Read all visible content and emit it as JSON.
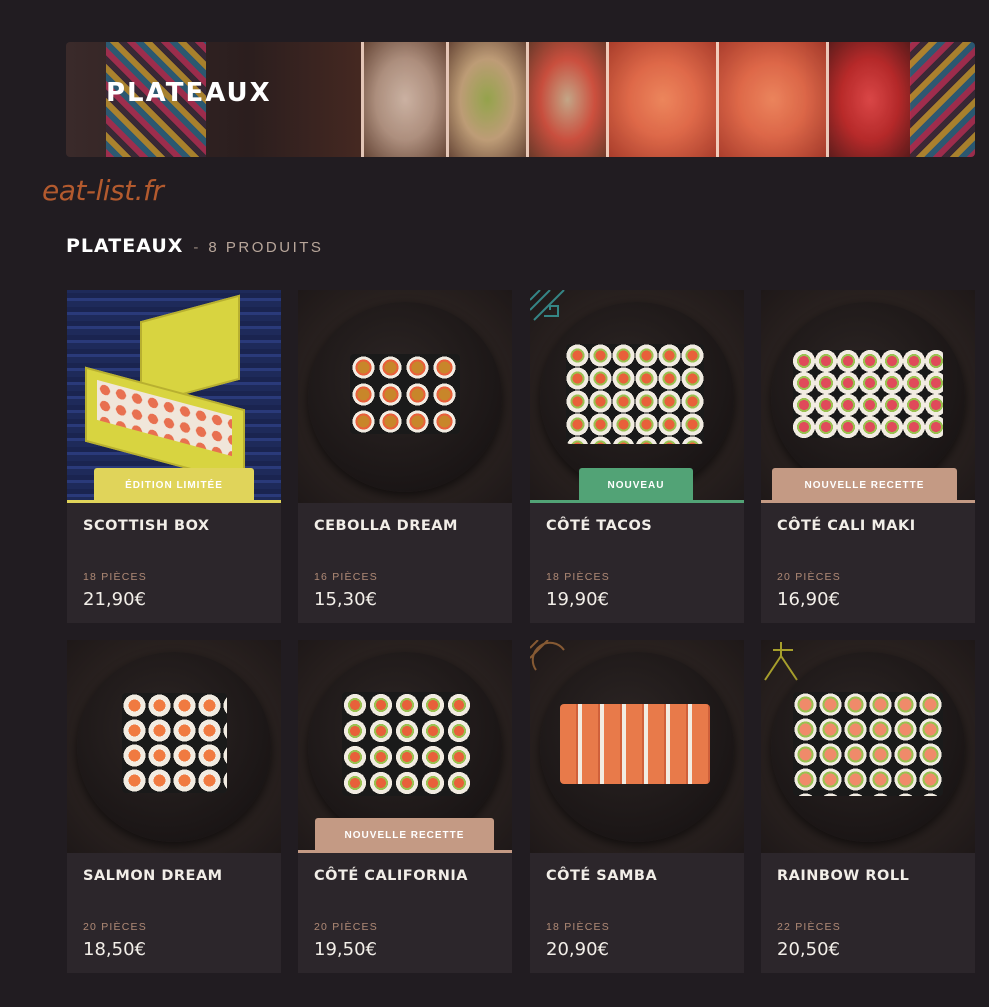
{
  "banner": {
    "title": "PLATEAUX"
  },
  "watermark": "eat-list.fr",
  "section": {
    "title": "PLATEAUX",
    "separator": "-",
    "count": "8 PRODUITS"
  },
  "colors": {
    "background": "#211c21",
    "card": "#2c262b",
    "badge_limited": "#e0d45a",
    "badge_new": "#52a376",
    "badge_recipe": "#c49a84",
    "price_pieces": "#b08a76"
  },
  "products": [
    {
      "name": "SCOTTISH BOX",
      "pieces": "18 PIÈCES",
      "price": "21,90€",
      "badge": "ÉDITION LIMITÉE"
    },
    {
      "name": "CEBOLLA DREAM",
      "pieces": "16 PIÈCES",
      "price": "15,30€",
      "badge": ""
    },
    {
      "name": "CÔTÉ TACOS",
      "pieces": "18 PIÈCES",
      "price": "19,90€",
      "badge": "NOUVEAU"
    },
    {
      "name": "CÔTÉ CALI MAKI",
      "pieces": "20 PIÈCES",
      "price": "16,90€",
      "badge": "NOUVELLE RECETTE"
    },
    {
      "name": "SALMON DREAM",
      "pieces": "20 PIÈCES",
      "price": "18,50€",
      "badge": ""
    },
    {
      "name": "CÔTÉ CALIFORNIA",
      "pieces": "20 PIÈCES",
      "price": "19,50€",
      "badge": "NOUVELLE RECETTE"
    },
    {
      "name": "CÔTÉ SAMBA",
      "pieces": "18 PIÈCES",
      "price": "20,90€",
      "badge": ""
    },
    {
      "name": "RAINBOW ROLL",
      "pieces": "22 PIÈCES",
      "price": "20,50€",
      "badge": ""
    }
  ]
}
